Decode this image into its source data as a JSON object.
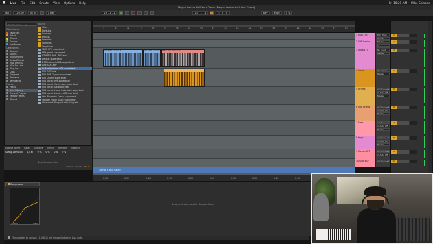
{
  "menubar": {
    "apple": "",
    "items": [
      "Live",
      "File",
      "Edit",
      "Create",
      "View",
      "Options",
      "Help"
    ],
    "right": [
      "Fri 10:21 AM",
      "Mike Shinoda"
    ]
  },
  "window": {
    "title": "Megan Lenius-Hol! Your Game  [Megan Lenius-Hol! Your Game]"
  },
  "transport": {
    "link": "Tap",
    "tempo": "120.00",
    "sig": "4 / 4",
    "metronome": "",
    "quant": "1 Bar",
    "position": "25 . 1 . 1",
    "loop_start": "25 . 1 . 1",
    "loop_len": "4 . 0 . 0",
    "key": "Key",
    "midi": "MIDI",
    "cpu": "4 %"
  },
  "browser": {
    "search_placeholder": "Search (Cmd + F)",
    "collections_label": "Collections",
    "collections": [
      "Favorites",
      "Vocals",
      "Chains",
      "Sounds",
      "Use Mode"
    ],
    "categories_label": "Categories",
    "categories": [
      "Sounds",
      "Drums",
      "Instruments",
      "Audio Effects",
      "MIDI Effects",
      "Max for Live",
      "Plug-Ins",
      "Clips",
      "Samples",
      "Grooves",
      "Templates"
    ],
    "places_label": "Places",
    "places": [
      "Packs",
      "User Library",
      "Current Project",
      "Factory Packs",
      "Shared"
    ],
    "name_header": "Name",
    "files": [
      "Clips",
      "Defaults",
      "Grooves",
      "Presets",
      "Sampler",
      "Samples",
      "Templates",
      "120B 8PS superbeat",
      "8Bit growl superbeat",
      "8ZYNBO BOX...BIG.adv",
      "Default superbeat",
      "D7D Industrial 8Bs superbeat",
      "LIVE SOC.adv",
      "Guitar Ambient 808 superbeat",
      "MIO OUT.adv",
      "MID 808 Clipper superbeat",
      "MID Drums superbeat",
      "MID vocal phrs superbeat",
      "MID vocal effect...eep superbeat",
      "MID vocal 808 superbeat",
      "MID vocal chorus tube tech superbeat",
      "MID vocal shorts ...LITE.exp beat",
      "Obs Blueprint Crash superbeat",
      "Smooth Vocal Disco superbeat",
      "Ultraviolet Bodyroll with King.adv"
    ],
    "selected_file_index": 13
  },
  "groove": {
    "cols": [
      "Groove Name",
      "Base",
      "Quantize",
      "Timing",
      "Random",
      "Velocity"
    ],
    "vals": [
      "Swing 16ths 56T",
      "1/16T",
      "0 %",
      "0 %",
      "0 %",
      "0 %"
    ],
    "drop_text": "Drop Grooves Here",
    "global_label": "Global Amount",
    "global_value": "100 %"
  },
  "arrangement": {
    "ruler_ticks": [
      "1",
      "5",
      "9",
      "13",
      "17",
      "21",
      "25",
      "29",
      "33",
      "37",
      "41",
      "45",
      "49",
      "53",
      "57",
      "61",
      "65",
      "69",
      "73",
      "77",
      "81"
    ],
    "bottom_ticks": [
      "0:00",
      "0:05",
      "0:10",
      "0:15",
      "0:20",
      "0:25",
      "0:30",
      "0:35",
      "0:40",
      "0:45",
      "0:50",
      "0:55"
    ],
    "clips": [
      {
        "name": "20 SYN Lenius 2",
        "color": "blue"
      },
      {
        "name": "20 SYN Lenius 3",
        "color": "blue"
      },
      {
        "name": "8 FX DLY Lenius 2",
        "color": "red"
      },
      {
        "name": "",
        "color": "orange"
      }
    ],
    "master_label": "36 Hol 1 Your Game 1"
  },
  "tracks": [
    {
      "name": "1 MIDI OUT",
      "color": "#e38ad0",
      "io": [
        "MIDI From",
        "All Ins",
        "Monitor"
      ],
      "num": "1"
    },
    {
      "name": "2 SYN Lenius",
      "color": "#e38ad0",
      "io": [
        "Ext. In",
        "1",
        "Monitor"
      ],
      "num": "2"
    },
    {
      "name": "3 vocals FX",
      "color": "#e38ad0",
      "io": [
        "No Input",
        "Master"
      ],
      "num": "3"
    },
    {
      "name": "4 loops",
      "color": "#d9951f",
      "io": [
        "Resampling",
        "Master"
      ],
      "num": "4"
    },
    {
      "name": "5 Drums",
      "color": "#e0b050",
      "io": [
        "All Channels",
        "In Auto Off",
        "Master"
      ],
      "num": "5"
    },
    {
      "name": "6 Vox Drums",
      "color": "#e8a070",
      "io": [
        "All Channels",
        "In Auto Off",
        "Master"
      ],
      "num": "6"
    },
    {
      "name": "7 Bass",
      "color": "#ff99aa",
      "io": [
        "All Channels",
        "In Auto Off",
        "Master"
      ],
      "num": "7"
    },
    {
      "name": "8 Keys",
      "color": "#e38ad0",
      "io": [
        "All Channels",
        "In Auto Off",
        "Master"
      ],
      "num": "8"
    },
    {
      "name": "9 Megan STR",
      "color": "#ff8fa0",
      "io": [
        "All Channels",
        "In Auto Off"
      ],
      "num": "9"
    },
    {
      "name": "10 Sub Tour",
      "color": "#ff8fa0",
      "io": [
        "All Channels"
      ],
      "num": "10"
    }
  ],
  "detail": {
    "device_name": "Compressor",
    "knob_labels": [
      "Thresh",
      "Ratio"
    ],
    "drop_text": "Drop an Instrument or Sample Here"
  },
  "status": {
    "text": "The updates to version 11.0.6/11 will be applied when Live exits."
  }
}
